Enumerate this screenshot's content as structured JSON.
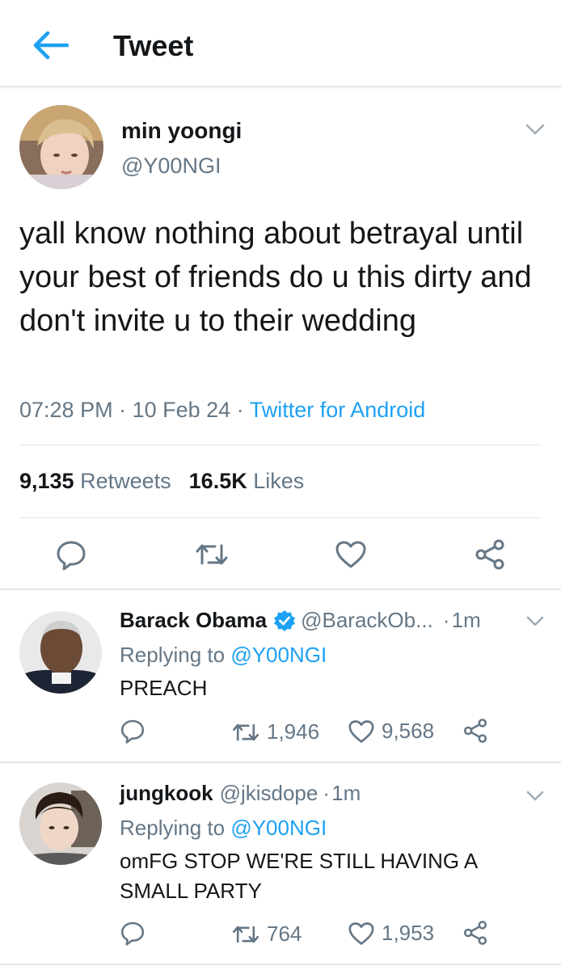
{
  "header": {
    "title": "Tweet",
    "back_icon": "arrow-left-icon"
  },
  "tweet": {
    "author_name": "min yoongi",
    "author_handle": "@Y00NGI",
    "text": "yall know nothing about betrayal until your best of friends do u this dirty and don't invite u to their wedding",
    "time": "07:28 PM",
    "date": "10 Feb 24",
    "source": "Twitter for Android",
    "retweet_count": "9,135",
    "retweet_label": "Retweets",
    "like_count": "16.5K",
    "like_label": "Likes"
  },
  "replies": [
    {
      "name": "Barack Obama",
      "verified": true,
      "handle": "@BarackOb...",
      "time": "1m",
      "replying_label": "Replying to",
      "replying_to": "@Y00NGI",
      "text": "PREACH",
      "retweets": "1,946",
      "likes": "9,568"
    },
    {
      "name": "jungkook",
      "verified": false,
      "handle": "@jkisdope",
      "time": "1m",
      "replying_label": "Replying to",
      "replying_to": "@Y00NGI",
      "text": "omFG STOP WE'RE STILL HAVING A SMALL PARTY",
      "retweets": "764",
      "likes": "1,953"
    }
  ],
  "colors": {
    "accent": "#1da1f2",
    "text": "#14171a",
    "secondary": "#657786",
    "divider": "#e1e8ed"
  }
}
